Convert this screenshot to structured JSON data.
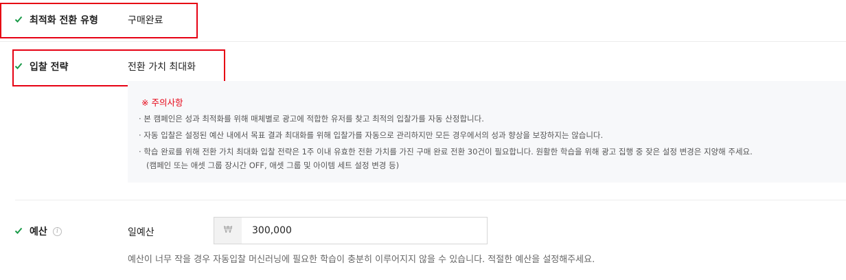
{
  "conversion_type": {
    "label": "최적화 전환 유형",
    "value": "구매완료"
  },
  "bid_strategy": {
    "label": "입찰 전략",
    "value": "전환 가치 최대화"
  },
  "notice": {
    "title": "※ 주의사항",
    "items": [
      "· 본 캠페인은 성과 최적화를 위해 매체별로 광고에 적합한 유저를 찾고 최적의 입찰가를 자동 산정합니다.",
      "· 자동 입찰은 설정된 예산 내에서 목표 결과 최대화를 위해 입찰가를 자동으로 관리하지만 모든 경우에서의 성과 향상을 보장하지는 않습니다.",
      "· 학습 완료를 위해 전환 가치 최대화 입찰 전략은 1주 이내 유효한 전환 가치를 가진 구매 완료 전환 30건이 필요합니다. 원활한 학습을 위해 광고 집행 중 잦은 설정 변경은 지양해 주세요.",
      "(캠페인 또는 애셋 그룹 장시간 OFF, 애셋 그룹 및 아이템 세트 설정 변경 등)"
    ]
  },
  "budget": {
    "label": "예산",
    "info_icon": "info-circle-icon",
    "period_label": "일예산",
    "currency_symbol": "₩",
    "amount": "300,000",
    "helper_text": "예산이 너무 작을 경우 자동입찰 머신러닝에 필요한 학습이 충분히 이루어지지 않을 수 있습니다. 적절한 예산을 설정해주세요."
  },
  "colors": {
    "check": "#1a9a48",
    "highlight_box": "#e60012",
    "notice_title": "#e60012",
    "notice_bg": "#f7f8fa"
  }
}
